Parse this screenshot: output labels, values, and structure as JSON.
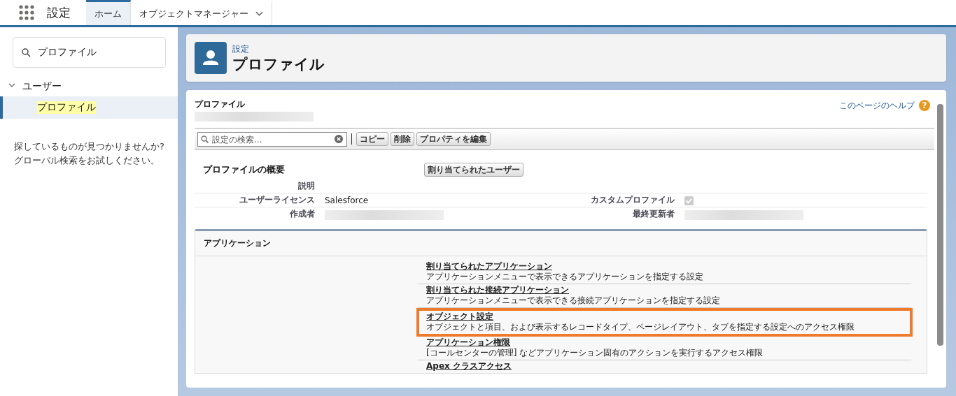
{
  "top_bar": {
    "app_title": "設定",
    "tabs": [
      {
        "label": "ホーム",
        "selected": true,
        "has_menu": false
      },
      {
        "label": "オブジェクトマネージャー",
        "selected": false,
        "has_menu": true
      }
    ]
  },
  "sidebar": {
    "search": {
      "value": "プロファイル"
    },
    "tree": [
      {
        "label": "ユーザー",
        "expanded": true,
        "children": [
          {
            "label": "プロファイル",
            "selected": true,
            "matched": true
          }
        ]
      }
    ],
    "empty_hint": [
      "探しているものが見つかりませんか?",
      "グローバル検索をお試しください。"
    ]
  },
  "page_header": {
    "breadcrumb": "設定",
    "title": "プロファイル"
  },
  "detail": {
    "label": "プロファイル",
    "help_link": "このページのヘルプ",
    "help_badge": "?",
    "search": {
      "placeholder": "設定の検索..."
    },
    "buttons": [
      "コピー",
      "削除",
      "プロパティを編集"
    ],
    "summary": {
      "title": "プロファイルの概要",
      "button": "割り当てられたユーザー",
      "rows": [
        {
          "left": {
            "label": "説明",
            "kind": "empty"
          }
        },
        {
          "left": {
            "label": "ユーザーライセンス",
            "kind": "text",
            "value": "Salesforce"
          },
          "right": {
            "label": "カスタムプロファイル",
            "kind": "checkbox",
            "checked": true,
            "disabled": true
          }
        },
        {
          "left": {
            "label": "作成者",
            "kind": "redacted"
          },
          "right": {
            "label": "最終更新者",
            "kind": "redacted"
          }
        }
      ]
    },
    "section": {
      "title": "アプリケーション",
      "items": [
        {
          "title": "割り当てられたアプリケーション",
          "description": "アプリケーションメニューで表示できるアプリケーションを指定する設定",
          "highlighted": false
        },
        {
          "title": "割り当てられた接続アプリケーション",
          "description": "アプリケーションメニューで表示できる接続アプリケーションを指定する設定",
          "highlighted": false
        },
        {
          "title": "オブジェクト設定",
          "description": "オブジェクトと項目、および表示するレコードタイプ、ページレイアウト、タブを指定する設定へのアクセス権限",
          "highlighted": true
        },
        {
          "title": "アプリケーション権限",
          "description": "[コールセンターの管理] などアプリケーション固有のアクションを実行するアクセス権限",
          "highlighted": false
        },
        {
          "title": "Apex クラスアクセス",
          "highlighted": false
        }
      ]
    }
  }
}
